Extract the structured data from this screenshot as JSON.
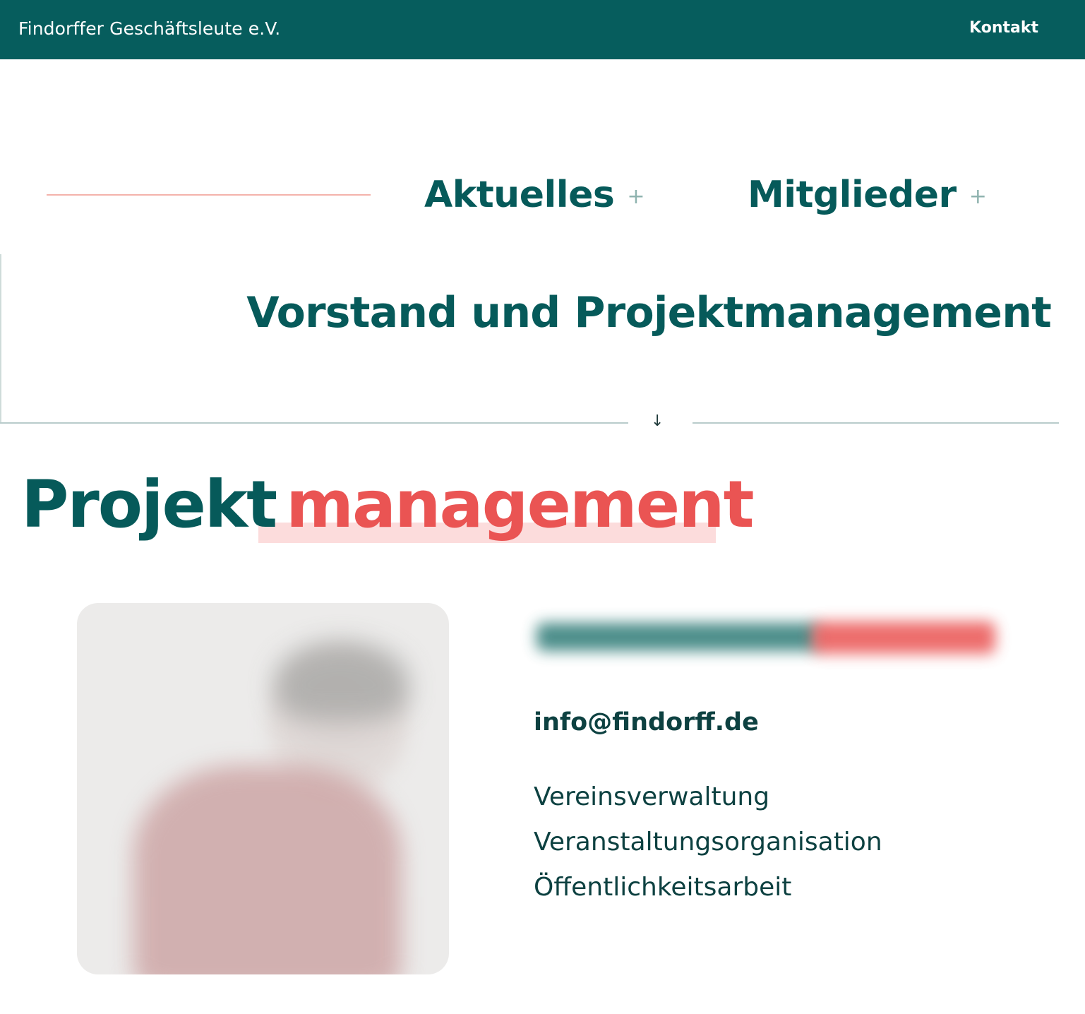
{
  "header": {
    "org_name": "Findorffer Geschäftsleute e.V.",
    "contact_label": "Kontakt"
  },
  "nav": {
    "items": [
      {
        "label": "Aktuelles",
        "icon": "plus-icon"
      },
      {
        "label": "Mitglieder",
        "icon": "plus-icon"
      }
    ]
  },
  "section": {
    "heading": "Vorstand und Projektmanagement",
    "divider_icon": "arrow-down-icon"
  },
  "title": {
    "part1": "Projekt",
    "part2": "management"
  },
  "person": {
    "email": "info@findorff.de",
    "roles": [
      "Vereinsverwaltung",
      "Veranstaltungsorganisation",
      "Öffentlichkeitsarbeit"
    ]
  },
  "colors": {
    "primary": "#065d5d",
    "accent": "#ea5453",
    "accent_light": "#fcdcdc"
  }
}
